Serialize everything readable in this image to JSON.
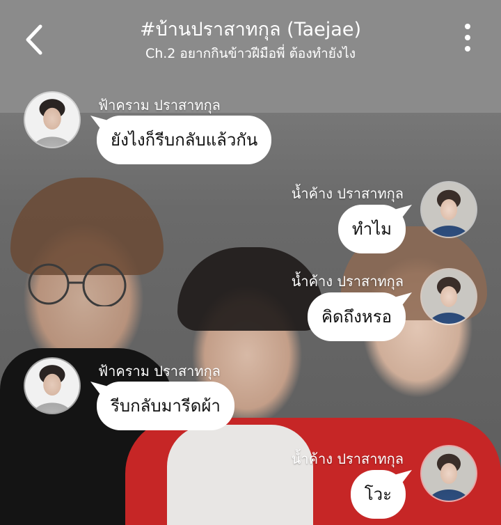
{
  "header": {
    "title": "#บ้านปราสาทกุล (Taejae)",
    "subtitle": "Ch.2 อยากกินข้าวฝีมือพี่ ต้องทำยังไง",
    "back_icon": "back-arrow-icon",
    "menu_icon": "more-vertical-icon"
  },
  "messages": [
    {
      "sender": "ฟ้าคราม ปราสาทกุล",
      "text": "ยังไงก็รีบกลับแล้วกัน",
      "side": "left"
    },
    {
      "sender": "น้ำค้าง ปราสาทกุล",
      "text": "ทำไม",
      "side": "right"
    },
    {
      "sender": "น้ำค้าง ปราสาทกุล",
      "text": "คิดถึงหรอ",
      "side": "right"
    },
    {
      "sender": "ฟ้าคราม ปราสาทกุล",
      "text": "รีบกลับมารีดผ้า",
      "side": "left"
    },
    {
      "sender": "น้ำค้าง ปราสาทกุล",
      "text": "โวะ",
      "side": "right"
    }
  ],
  "colors": {
    "header_bg": "#8b8b8b",
    "bubble_bg": "#ffffff",
    "bubble_text": "#111111"
  }
}
